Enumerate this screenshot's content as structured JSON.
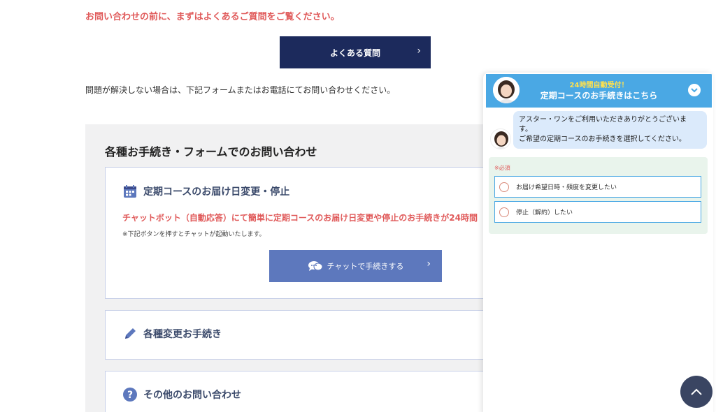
{
  "notice": "お問い合わせの前に、まずはよくあるご質問をご覧ください。",
  "faq_button": {
    "label": "よくある質問",
    "chevron": "›"
  },
  "lead": "問題が解決しない場合は、下記フォームまたはお電話にてお問い合わせください。",
  "panel": {
    "title": "各種お手続き・フォームでのお問い合わせ",
    "cards": [
      {
        "icon": "calendar-icon",
        "title": "定期コースのお届け日変更・停止",
        "red_text": "チャットボット（自動応答）にて簡単に定期コースのお届け日変更や停止のお手続きが24時間",
        "note": "※下記ボタンを押すとチャットが起動いたします。",
        "button_label": "チャットで手続きする",
        "button_chevron": "›"
      },
      {
        "icon": "pencil-icon",
        "title": "各種変更お手続き"
      },
      {
        "icon": "question-icon",
        "title": "その他のお問い合わせ"
      }
    ]
  },
  "chat_widget": {
    "subtitle": "24時間自動受付！",
    "title": "定期コースのお手続きはこちら",
    "message_lines": [
      "アスター・ワンをご利用いただきありがとうございま",
      "す。",
      "ご希望の定期コースのお手続きを選択してください。"
    ],
    "required_label": "※必須",
    "options": [
      "お届け希望日時・頻度を変更したい",
      "停止（解約）したい"
    ]
  },
  "colors": {
    "navy": "#1c2a5c",
    "accent_red": "#e05a5a",
    "chat_blue": "#4aa8e4",
    "button_blue": "#5d78bd"
  }
}
